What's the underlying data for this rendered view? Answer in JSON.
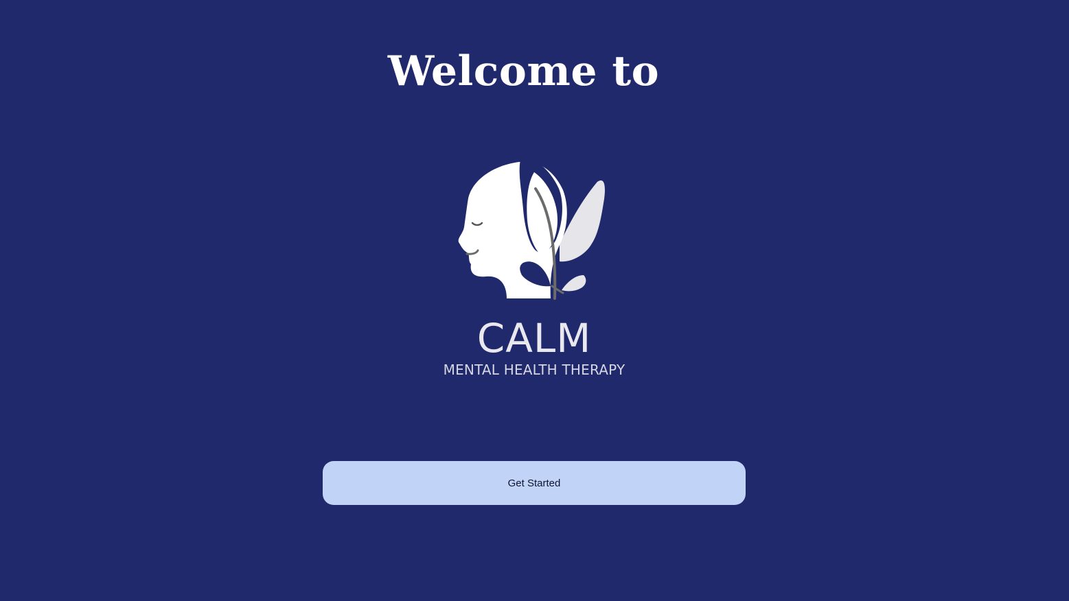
{
  "welcome": {
    "title": "Welcome to"
  },
  "logo": {
    "icon": "head-with-leaf-icon",
    "brand_name": "CALM",
    "tagline": "MENTAL HEALTH THERAPY"
  },
  "actions": {
    "get_started_label": "Get Started"
  },
  "colors": {
    "background": "#20296c",
    "button": "#c1d3f7",
    "button_text": "#0f1432",
    "title": "#ffffff"
  }
}
